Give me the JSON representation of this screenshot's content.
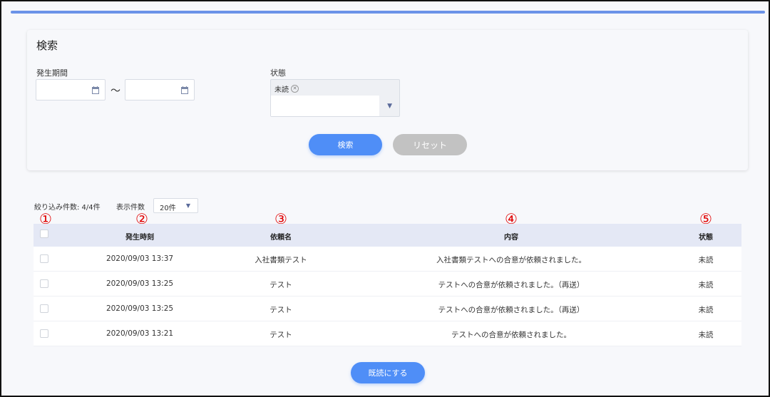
{
  "search": {
    "title": "検索",
    "period_label": "発生期間",
    "period_from": "",
    "period_to": "",
    "period_separator": "～",
    "status_label": "状態",
    "status_selected_tag": "未読",
    "search_button": "検索",
    "reset_button": "リセット"
  },
  "list": {
    "filter_count": "絞り込み件数: 4/4件",
    "per_page_label": "表示件数",
    "per_page_value": "20件",
    "columns": {
      "occurred_at": "発生時刻",
      "request_name": "依頼名",
      "content": "内容",
      "status": "状態"
    },
    "markers": [
      "①",
      "②",
      "③",
      "④",
      "⑤"
    ],
    "rows": [
      {
        "occurred_at": "2020/09/03 13:37",
        "request_name": "入社書類テスト",
        "content": "入社書類テストへの合意が依頼されました。",
        "status": "未読"
      },
      {
        "occurred_at": "2020/09/03 13:25",
        "request_name": "テスト",
        "content": "テストへの合意が依頼されました。（再送）",
        "status": "未読"
      },
      {
        "occurred_at": "2020/09/03 13:25",
        "request_name": "テスト",
        "content": "テストへの合意が依頼されました。（再送）",
        "status": "未読"
      },
      {
        "occurred_at": "2020/09/03 13:21",
        "request_name": "テスト",
        "content": "テストへの合意が依頼されました。",
        "status": "未読"
      }
    ],
    "mark_read_button": "既読にする"
  },
  "colors": {
    "accent": "#4f8ef7",
    "header_bg": "#e4e8f5",
    "marker": "#e10000",
    "reset_bg": "#c2c2c2"
  }
}
